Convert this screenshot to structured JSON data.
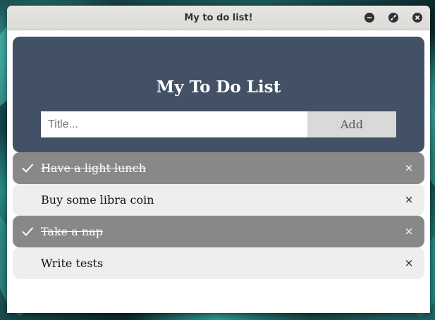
{
  "window": {
    "title": "My to do list!",
    "controls": {
      "minimize_icon": "minimize-icon",
      "maximize_icon": "maximize-icon",
      "close_icon": "close-icon"
    }
  },
  "header": {
    "title": "My To Do List",
    "input": {
      "value": "",
      "placeholder": "Title..."
    },
    "add_label": "Add",
    "background_color": "#435166"
  },
  "todos": [
    {
      "text": "Have a light lunch",
      "checked": true
    },
    {
      "text": "Buy some libra coin",
      "checked": false
    },
    {
      "text": "Take a nap",
      "checked": true
    },
    {
      "text": "Write tests",
      "checked": false
    }
  ],
  "item": {
    "close_glyph": "×",
    "check_icon": "checkmark-icon"
  },
  "colors": {
    "checked_bg": "#888888",
    "unchecked_bg": "#eeeeee",
    "add_button_bg": "#d9d9d9"
  }
}
